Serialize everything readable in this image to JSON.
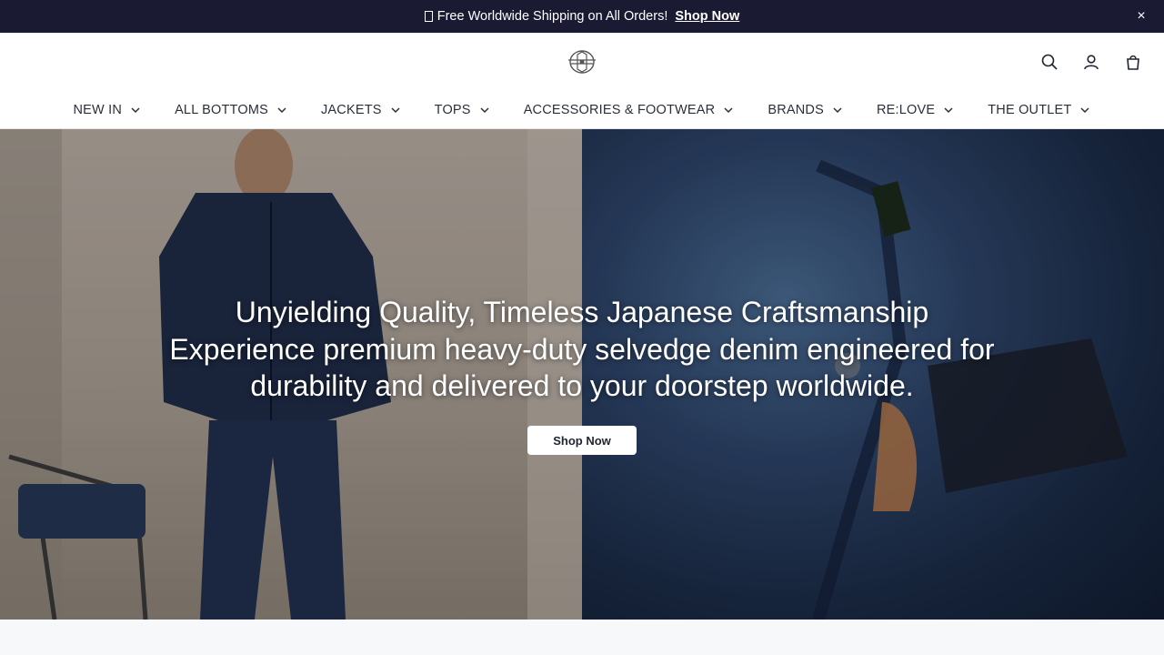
{
  "announcement": {
    "message": "Free Worldwide Shipping on All Orders!",
    "link_label": "Shop Now",
    "close_label": "×"
  },
  "header": {
    "logo_icon": "brand-logo-emblem",
    "icons": [
      "search-icon",
      "account-icon",
      "cart-icon"
    ]
  },
  "nav": {
    "items": [
      {
        "label": "NEW IN"
      },
      {
        "label": "ALL BOTTOMS"
      },
      {
        "label": "JACKETS"
      },
      {
        "label": "TOPS"
      },
      {
        "label": "ACCESSORIES & FOOTWEAR"
      },
      {
        "label": "BRANDS"
      },
      {
        "label": "RE:LOVE"
      },
      {
        "label": "THE OUTLET"
      }
    ]
  },
  "hero": {
    "title": "Unyielding Quality, Timeless Japanese Craftsmanship",
    "subtitle": "Experience premium heavy-duty selvedge denim engineered for durability and delivered to your doorstep worldwide.",
    "button_label": "Shop Now"
  },
  "colors": {
    "announcement_bg": "#1b1a33",
    "text_dark": "#2b2f3a",
    "hero_left_tone": "#b8aea4",
    "hero_right_tone": "#2d4469"
  }
}
